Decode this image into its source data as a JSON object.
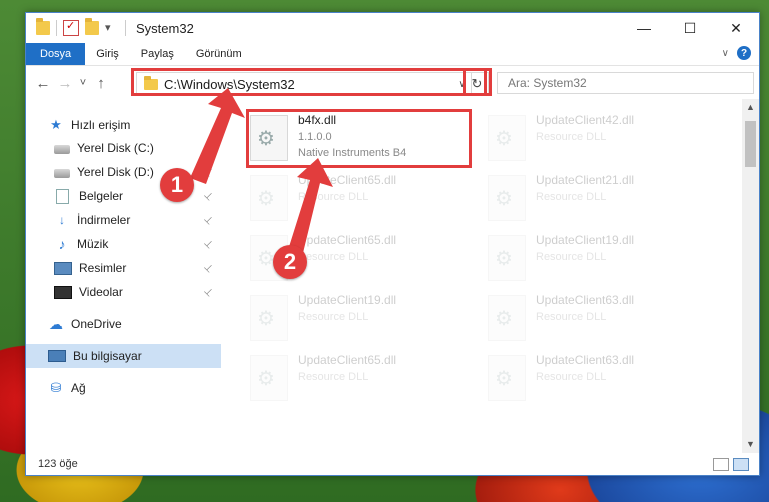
{
  "window": {
    "title": "System32",
    "controls": {
      "minimize": "—",
      "maximize": "☐",
      "close": "✕"
    }
  },
  "ribbon": {
    "tabs": [
      "Dosya",
      "Giriş",
      "Paylaş",
      "Görünüm"
    ],
    "help": "?"
  },
  "nav": {
    "back": "←",
    "forward": "→",
    "recent": "˅",
    "up": "↑",
    "address": "C:\\Windows\\System32",
    "address_dropdown": "∨",
    "refresh": "↻",
    "search_placeholder": "Ara: System32"
  },
  "sidebar": {
    "items": [
      {
        "label": "Hızlı erişim",
        "icon": "star-icon"
      },
      {
        "label": "Yerel Disk (C:)",
        "icon": "disk-icon",
        "pinned": true
      },
      {
        "label": "Yerel Disk (D:)",
        "icon": "disk-icon",
        "pinned": true
      },
      {
        "label": "Belgeler",
        "icon": "document-icon",
        "pinned": true
      },
      {
        "label": "İndirmeler",
        "icon": "download-icon",
        "pinned": true
      },
      {
        "label": "Müzik",
        "icon": "music-icon",
        "pinned": true
      },
      {
        "label": "Resimler",
        "icon": "picture-icon",
        "pinned": true
      },
      {
        "label": "Videolar",
        "icon": "video-icon",
        "pinned": true
      },
      {
        "label": "OneDrive",
        "icon": "cloud-icon"
      },
      {
        "label": "Bu bilgisayar",
        "icon": "computer-icon",
        "selected": true
      },
      {
        "label": "Ağ",
        "icon": "network-icon"
      }
    ],
    "pin_glyph": "📌"
  },
  "files": [
    {
      "name": "b4fx.dll",
      "sub1": "1.1.0.0",
      "sub2": "Native Instruments B4",
      "faded": false
    },
    {
      "name": "UpdateClient42.dll",
      "sub1": "Resource DLL",
      "faded": true
    },
    {
      "name": "UpdateClient65.dll",
      "sub1": "Resource DLL",
      "faded": true
    },
    {
      "name": "UpdateClient21.dll",
      "sub1": "Resource DLL",
      "faded": true
    },
    {
      "name": "UpdateClient65.dll",
      "sub1": "Resource DLL",
      "faded": true
    },
    {
      "name": "UpdateClient19.dll",
      "sub1": "Resource DLL",
      "faded": true
    },
    {
      "name": "UpdateClient19.dll",
      "sub1": "Resource DLL",
      "faded": true
    },
    {
      "name": "UpdateClient63.dll",
      "sub1": "Resource DLL",
      "faded": true
    },
    {
      "name": "UpdateClient65.dll",
      "sub1": "Resource DLL",
      "faded": true
    },
    {
      "name": "UpdateClient63.dll",
      "sub1": "Resource DLL",
      "faded": true
    }
  ],
  "status": {
    "count": "123 öğe"
  },
  "annotations": {
    "step1": "1",
    "step2": "2",
    "color": "#e23d3d"
  },
  "colors": {
    "accent": "#1f6fc6",
    "highlight": "#e23d3d",
    "selection": "#cce0f5"
  }
}
